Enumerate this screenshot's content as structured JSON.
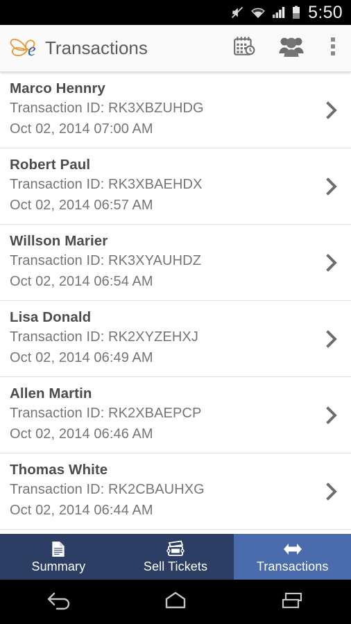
{
  "statusbar": {
    "time": "5:50",
    "icons": [
      "mute-icon",
      "wifi-icon",
      "signal-icon",
      "battery-icon"
    ]
  },
  "appbar": {
    "logo_icon": "butterfly-e-logo",
    "title": "Transactions",
    "actions": [
      {
        "icon": "calendar-clock-icon",
        "name": "calendar-button"
      },
      {
        "icon": "people-group-icon",
        "name": "people-button"
      },
      {
        "icon": "overflow-menu-icon",
        "name": "overflow-menu-button"
      }
    ]
  },
  "list": {
    "id_prefix": "Transaction ID: ",
    "items": [
      {
        "name": "Marco Hennry",
        "transaction_id": "Transaction ID: RK3XBZUHDG",
        "datetime": "Oct 02, 2014 07:00 AM"
      },
      {
        "name": "Robert Paul",
        "transaction_id": "Transaction ID: RK3XBAEHDX",
        "datetime": "Oct 02, 2014 06:57 AM"
      },
      {
        "name": "Willson Marier",
        "transaction_id": "Transaction ID: RK3XYAUHDZ",
        "datetime": "Oct 02, 2014 06:54 AM"
      },
      {
        "name": "Lisa Donald",
        "transaction_id": "Transaction ID: RK2XYZEHXJ",
        "datetime": "Oct 02, 2014 06:49 AM"
      },
      {
        "name": "Allen Martin",
        "transaction_id": "Transaction ID: RK2XBAEPCP",
        "datetime": "Oct 02, 2014 06:46 AM"
      },
      {
        "name": "Thomas White",
        "transaction_id": "Transaction ID: RK2CBAUHXG",
        "datetime": "Oct 02, 2014 06:44 AM"
      }
    ]
  },
  "tabbar": {
    "background": "#2c3e64",
    "active_background": "#4a6cac",
    "tabs": [
      {
        "label": "Summary",
        "icon": "document-icon",
        "active": false
      },
      {
        "label": "Sell Tickets",
        "icon": "ticket-icon",
        "active": false
      },
      {
        "label": "Transactions",
        "icon": "double-arrow-icon",
        "active": true
      }
    ]
  },
  "navbar": {
    "buttons": [
      {
        "name": "back-button",
        "icon": "back-arrow-icon"
      },
      {
        "name": "home-button",
        "icon": "home-icon"
      },
      {
        "name": "recents-button",
        "icon": "recents-icon"
      }
    ]
  }
}
